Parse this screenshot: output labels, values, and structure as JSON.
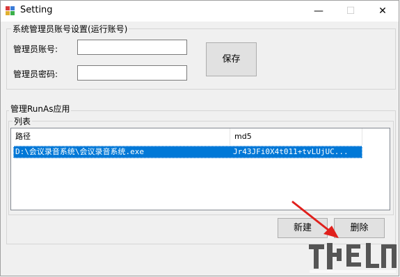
{
  "window": {
    "title": "Setting",
    "controls": {
      "minimize": "—",
      "maximize": "☐",
      "close": "✕"
    }
  },
  "admin_group": {
    "legend": "系统管理员账号设置(运行账号)",
    "account_label": "管理员账号:",
    "account_value": "",
    "password_label": "管理员密码:",
    "password_value": "",
    "save_label": "保存"
  },
  "runas_group": {
    "legend": "管理RunAs应用",
    "list_group": {
      "legend": "列表",
      "columns": [
        "路径",
        "md5"
      ],
      "rows": [
        {
          "path": "D:\\会议录音系统\\会议录音系统.exe",
          "md5": "Jr43JFi0X4t011+tvLUjUC...",
          "selected": true
        }
      ]
    },
    "new_label": "新建",
    "delete_label": "删除"
  },
  "colors": {
    "selection": "#0078d7",
    "arrow": "#e0201c",
    "window_bg": "#f0f0f0"
  },
  "icons": {
    "app": "app-window-icon",
    "annotation": "red-arrow-icon",
    "watermark": "watermark-logo"
  }
}
